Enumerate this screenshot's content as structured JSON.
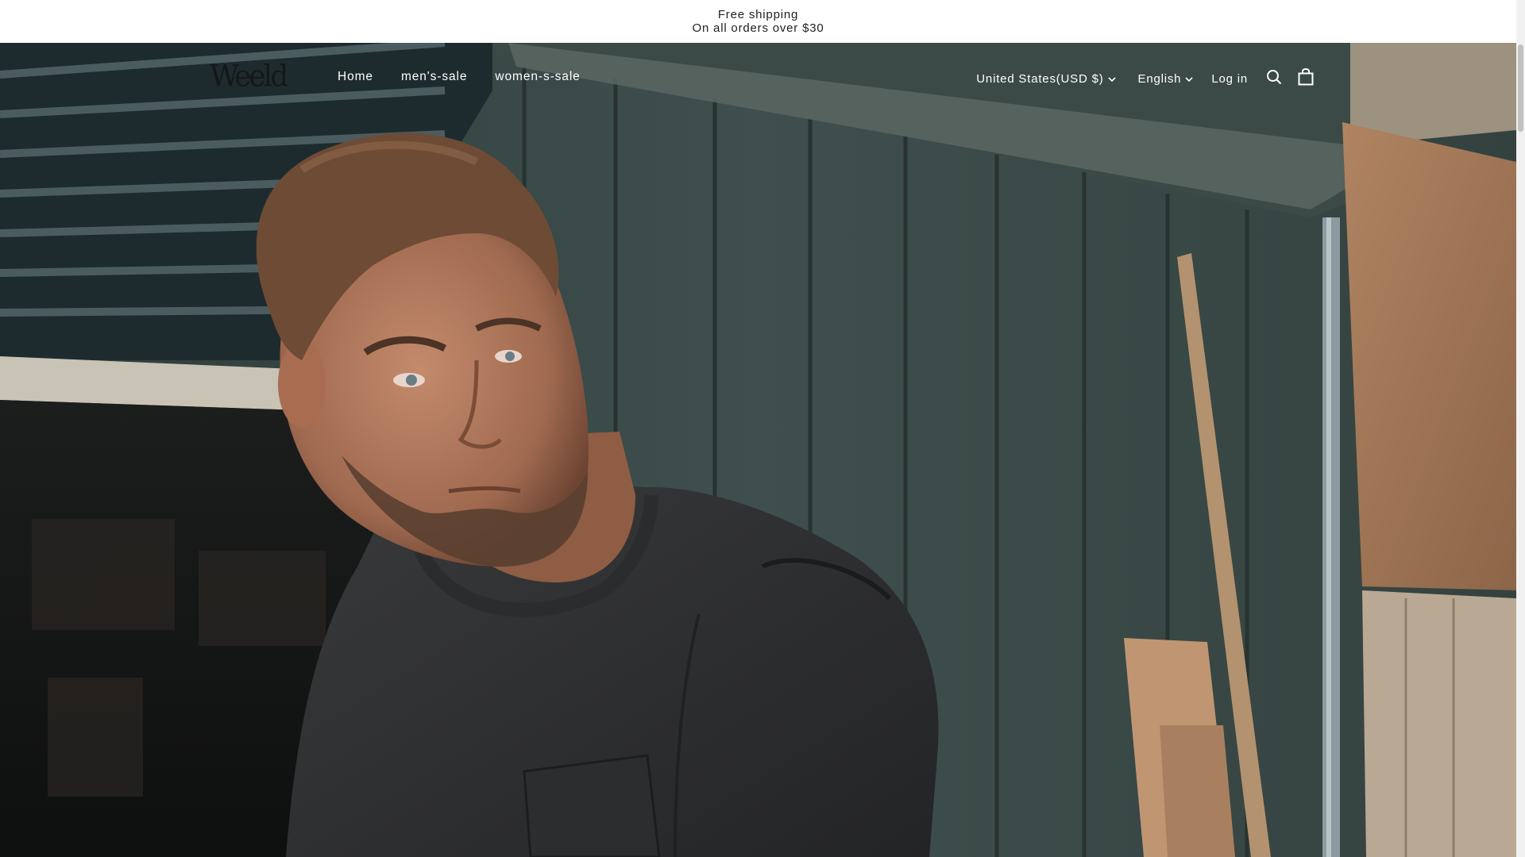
{
  "announcement": {
    "line1": "Free shipping",
    "line2": "On all orders over $30"
  },
  "header": {
    "logo": "Weeld",
    "nav": [
      {
        "label": "Home"
      },
      {
        "label": "men's-sale"
      },
      {
        "label": "women-s-sale"
      }
    ],
    "country_selector": "United States(USD $)",
    "language_selector": "English",
    "login": "Log in"
  },
  "icons": {
    "search": "search-icon",
    "cart": "cart-icon",
    "chevron": "chevron-down-icon"
  },
  "colors": {
    "announcement_bg": "#ffffff",
    "header_text": "#ffffff",
    "hero_bg": "#33413f"
  }
}
